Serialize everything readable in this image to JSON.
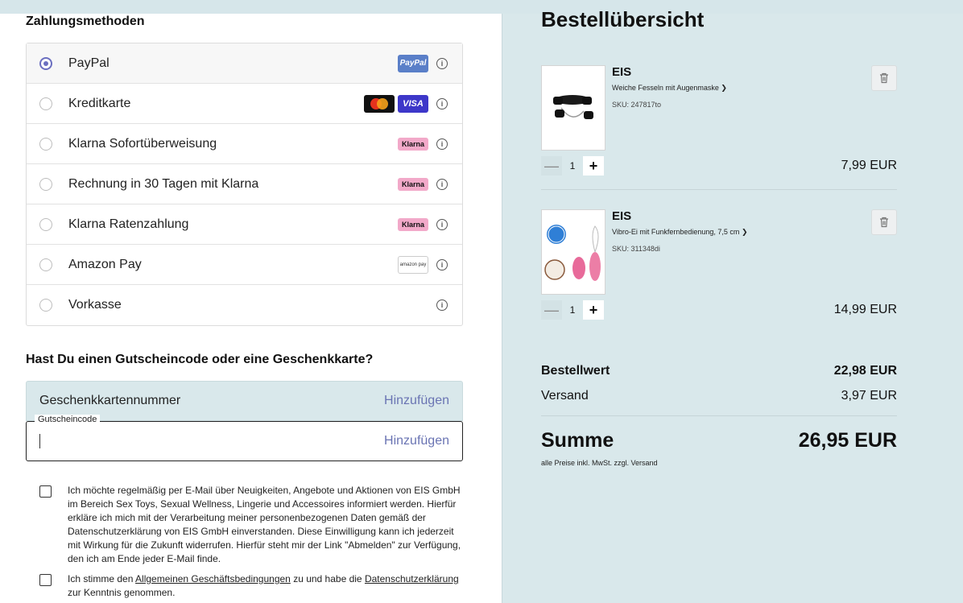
{
  "payment": {
    "title": "Zahlungsmethoden",
    "methods": [
      {
        "label": "PayPal",
        "selected": true
      },
      {
        "label": "Kreditkarte",
        "selected": false
      },
      {
        "label": "Klarna Sofortüberweisung",
        "selected": false
      },
      {
        "label": "Rechnung in 30 Tagen mit Klarna",
        "selected": false
      },
      {
        "label": "Klarna Ratenzahlung",
        "selected": false
      },
      {
        "label": "Amazon Pay",
        "selected": false
      },
      {
        "label": "Vorkasse",
        "selected": false
      }
    ],
    "logo_texts": {
      "paypal": "PayPal",
      "visa": "VISA",
      "klarna": "Klarna",
      "amazon": "amazon pay"
    },
    "colors": {
      "accent": "#6b6fc0",
      "klarna": "#f2a9c9",
      "paypal": "#5a7fc8",
      "visa": "#3d37c9"
    }
  },
  "voucher": {
    "title": "Hast Du einen Gutscheincode oder eine Geschenkkarte?",
    "gift_label": "Geschenkkartennummer",
    "gift_add": "Hinzufügen",
    "coupon_legend": "Gutscheincode",
    "coupon_value": "",
    "coupon_add": "Hinzufügen"
  },
  "consent": {
    "newsletter": "Ich möchte regelmäßig per E-Mail über Neuigkeiten, Angebote und Aktionen von EIS GmbH im Bereich Sex Toys, Sexual Wellness, Lingerie und Accessoires informiert werden. Hierfür erkläre ich mich mit der Verarbeitung meiner personenbezogenen Daten gemäß der Datenschutzerklärung von EIS GmbH einverstanden. Diese Einwilligung kann ich jederzeit mit Wirkung für die Zukunft widerrufen. Hierfür steht mir der Link \"Abmelden\" zur Verfügung, den ich am Ende jeder E-Mail finde.",
    "terms_prefix": "Ich stimme den ",
    "terms_link": "Allgemeinen Geschäftsbedingungen",
    "terms_mid": " zu und habe die ",
    "privacy_link": "Datenschutzerklärung",
    "terms_suffix": "zur Kenntnis genommen."
  },
  "overview": {
    "title": "Bestellübersicht",
    "items": [
      {
        "brand": "EIS",
        "name": "Weiche Fesseln mit Augenmaske",
        "sku": "SKU: 247817to",
        "qty": "1",
        "price": "7,99 EUR"
      },
      {
        "brand": "EIS",
        "name": "Vibro-Ei mit Funkfernbedienung, 7,5 cm",
        "sku": "SKU: 311348di",
        "qty": "1",
        "price": "14,99 EUR"
      }
    ],
    "subtotal_label": "Bestellwert",
    "subtotal_value": "22,98 EUR",
    "shipping_label": "Versand",
    "shipping_value": "3,97 EUR",
    "total_label": "Summe",
    "total_value": "26,95 EUR",
    "tax_note": "alle Preise inkl. MwSt. zzgl. Versand"
  }
}
